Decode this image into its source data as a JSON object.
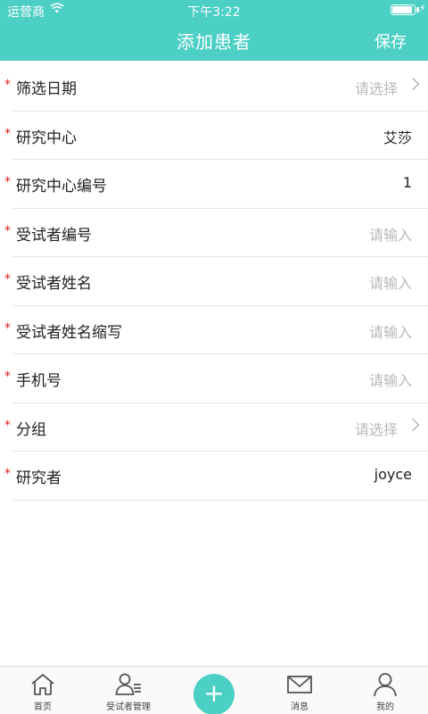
{
  "status_bar": {
    "carrier": "运营商",
    "time": "下午3:22",
    "battery_level": 0.95
  },
  "nav": {
    "title": "添加患者",
    "save_label": "保存"
  },
  "form": {
    "required_mark": "*",
    "rows": [
      {
        "label": "筛选日期",
        "value": "请选择",
        "placeholder": true,
        "chevron": true
      },
      {
        "label": "研究中心",
        "value": "艾莎",
        "placeholder": false,
        "chevron": false
      },
      {
        "label": "研究中心编号",
        "value": "1",
        "placeholder": false,
        "chevron": false
      },
      {
        "label": "受试者编号",
        "value": "请输入",
        "placeholder": true,
        "chevron": false
      },
      {
        "label": "受试者姓名",
        "value": "请输入",
        "placeholder": true,
        "chevron": false
      },
      {
        "label": "受试者姓名缩写",
        "value": "请输入",
        "placeholder": true,
        "chevron": false
      },
      {
        "label": "手机号",
        "value": "请输入",
        "placeholder": true,
        "chevron": false
      },
      {
        "label": "分组",
        "value": "请选择",
        "placeholder": true,
        "chevron": true
      },
      {
        "label": "研究者",
        "value": "joyce",
        "placeholder": false,
        "chevron": false
      }
    ]
  },
  "tab_bar": {
    "tabs": [
      {
        "label": "首页",
        "icon": "home-icon"
      },
      {
        "label": "受试者管理",
        "icon": "subject-manage-icon"
      },
      {
        "label": "",
        "icon": "add-icon",
        "glyph": "+"
      },
      {
        "label": "消息",
        "icon": "mail-icon"
      },
      {
        "label": "我的",
        "icon": "user-icon"
      }
    ]
  },
  "colors": {
    "accent": "#4ccfc4",
    "required": "#e02020",
    "placeholder": "#b9b9b9"
  }
}
